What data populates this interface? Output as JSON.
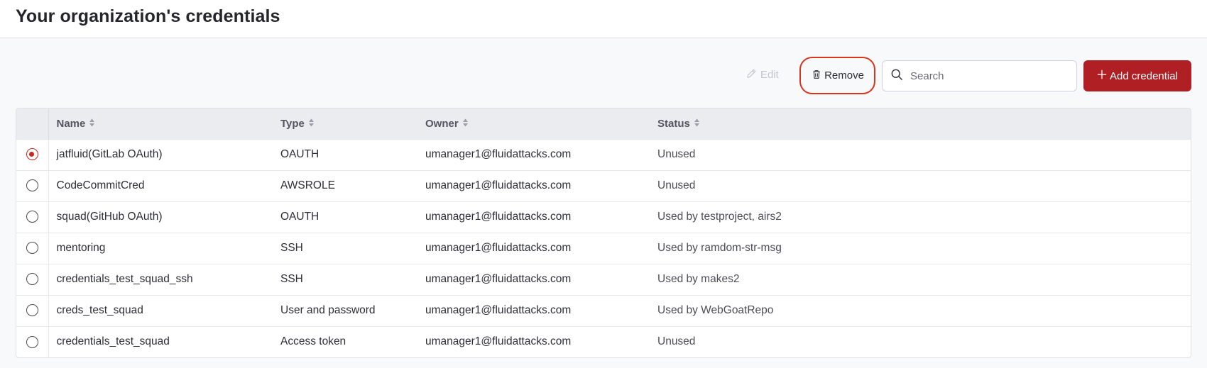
{
  "header": {
    "title": "Your organization's credentials"
  },
  "toolbar": {
    "edit_label": "Edit",
    "remove_label": "Remove",
    "search_placeholder": "Search",
    "add_label": "Add credential"
  },
  "colors": {
    "accent": "#b01f24",
    "highlight_outline": "#d9341c",
    "selected_radio": "#c42a20"
  },
  "table": {
    "columns": [
      "Name",
      "Type",
      "Owner",
      "Status"
    ],
    "rows": [
      {
        "selected": true,
        "name": "jatfluid(GitLab OAuth)",
        "type": "OAUTH",
        "owner": "umanager1@fluidattacks.com",
        "status": "Unused"
      },
      {
        "selected": false,
        "name": "CodeCommitCred",
        "type": "AWSROLE",
        "owner": "umanager1@fluidattacks.com",
        "status": "Unused"
      },
      {
        "selected": false,
        "name": "squad(GitHub OAuth)",
        "type": "OAUTH",
        "owner": "umanager1@fluidattacks.com",
        "status": "Used by testproject, airs2"
      },
      {
        "selected": false,
        "name": "mentoring",
        "type": "SSH",
        "owner": "umanager1@fluidattacks.com",
        "status": "Used by ramdom-str-msg"
      },
      {
        "selected": false,
        "name": "credentials_test_squad_ssh",
        "type": "SSH",
        "owner": "umanager1@fluidattacks.com",
        "status": "Used by makes2"
      },
      {
        "selected": false,
        "name": "creds_test_squad",
        "type": "User and password",
        "owner": "umanager1@fluidattacks.com",
        "status": "Used by WebGoatRepo"
      },
      {
        "selected": false,
        "name": "credentials_test_squad",
        "type": "Access token",
        "owner": "umanager1@fluidattacks.com",
        "status": "Unused"
      }
    ]
  },
  "icons": {
    "edit": "pencil-icon",
    "remove": "trash-icon",
    "search": "magnifier-icon",
    "add": "plus-icon",
    "sort": "sort-icon"
  }
}
